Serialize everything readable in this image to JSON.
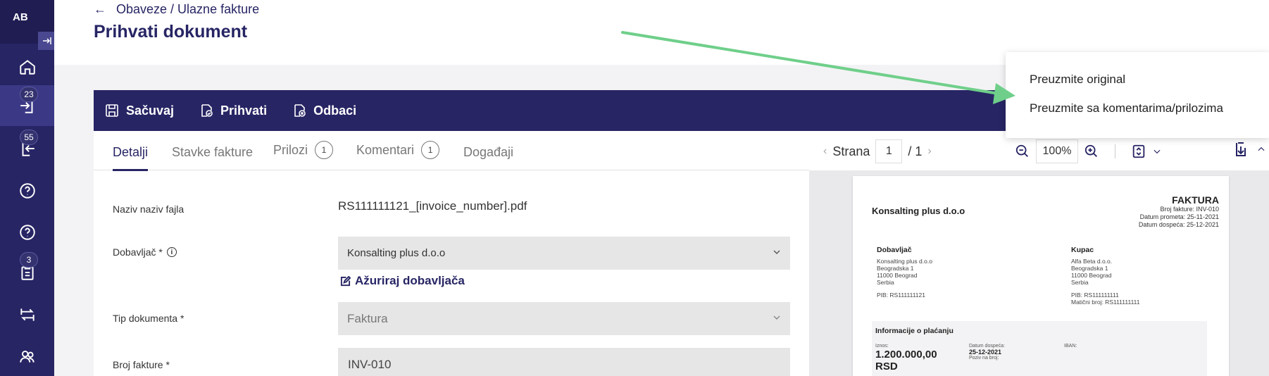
{
  "sidebar": {
    "initials": "AB",
    "badges": {
      "inbox": "23",
      "outbox": "55",
      "tasks": "3"
    }
  },
  "header": {
    "breadcrumb": "Obaveze / Ulazne fakture",
    "title": "Prihvati dokument"
  },
  "toolbar": {
    "save": "Sačuvaj",
    "accept": "Prihvati",
    "reject": "Odbaci"
  },
  "tabs": {
    "details": "Detalji",
    "items": "Stavke fakture",
    "attachments": "Prilozi",
    "attachments_count": "1",
    "comments": "Komentari",
    "comments_count": "1",
    "events": "Događaji"
  },
  "form": {
    "file_label": "Naziv naziv fajla",
    "file_value": "RS111111121_[invoice_number].pdf",
    "supplier_label": "Dobavljač *",
    "supplier_value": "Konsalting plus d.o.o",
    "update_supplier": "Ažuriraj dobavljača",
    "doc_type_label": "Tip dokumenta *",
    "doc_type_value": "Faktura",
    "invoice_no_label": "Broj fakture *",
    "invoice_no_value": "INV-010"
  },
  "viewer": {
    "page_label": "Strana",
    "page_current": "1",
    "page_total": "/ 1",
    "zoom": "100%"
  },
  "dropdown": {
    "download_original": "Preuzmite original",
    "download_with_comments": "Preuzmite sa komentarima/prilozima"
  },
  "invoice": {
    "company": "Konsalting plus d.o.o",
    "title": "FAKTURA",
    "meta": [
      "Broj fakture: INV-010",
      "Datum prometa: 25-11-2021",
      "Datum dospeća: 25-12-2021"
    ],
    "supplier_heading": "Dobavljač",
    "supplier_lines": [
      "Konsalting plus d.o.o",
      "Beogradska 1",
      "11000 Beograd",
      "Serbia"
    ],
    "supplier_pib": "PIB: RS111111121",
    "buyer_heading": "Kupac",
    "buyer_lines": [
      "Alfa Beta d.o.o.",
      "Beogradska 1",
      "11000 Beograd",
      "Serbia"
    ],
    "buyer_pib": "PIB: RS111111111",
    "buyer_mb": "Matični broj: RS111111111",
    "payment_heading": "Informacije o plaćanju",
    "amount_label": "Iznos:",
    "amount_value": "1.200.000,00",
    "amount_currency": "RSD",
    "due_label": "Datum dospeća:",
    "due_value": "25-12-2021",
    "ref_label": "Poziv na broj:",
    "iban_label": "IBAN:"
  },
  "colors": {
    "brand": "#272564",
    "arrow": "#6fcf8a"
  }
}
